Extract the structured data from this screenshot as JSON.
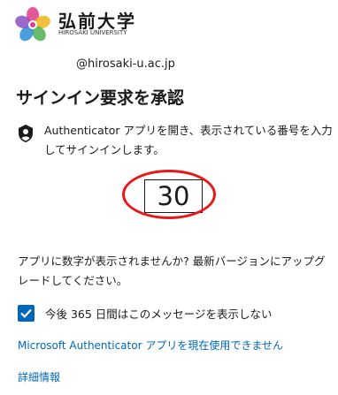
{
  "brand": {
    "name": "弘前大学",
    "subtitle": "HIROSAKI UNIVERSITY",
    "colors": {
      "petal_pink": "#e23a8c",
      "petal_blue": "#2c8fd6",
      "petal_yellow": "#f1b51c",
      "petal_green": "#4caf50",
      "petal_purple": "#8a4fc0"
    }
  },
  "account": "@hirosaki-u.ac.jp",
  "title": "サインイン要求を承認",
  "instruction": {
    "icon": "authenticator-lock-icon",
    "text": "Authenticator アプリを開き、表示されている番号を入力してサインインします。"
  },
  "number": "30",
  "highlight_color": "#e81818",
  "no_number_text": "アプリに数字が表示されませんか? 最新バージョンにアップグレードしてください。",
  "remember": {
    "checked": true,
    "label": "今後 365 日間はこのメッセージを表示しない"
  },
  "links": {
    "cannot_use": "Microsoft Authenticator アプリを現在使用できません",
    "more_info": "詳細情報"
  },
  "accent_color": "#0067b8"
}
